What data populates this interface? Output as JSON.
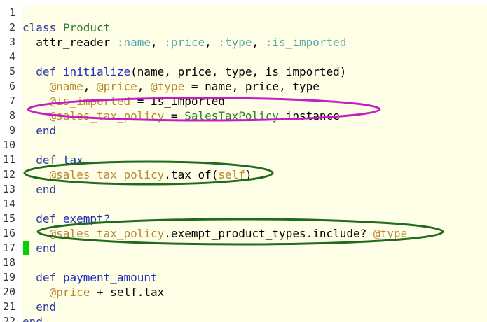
{
  "editor": {
    "lines": [
      {
        "num": "1",
        "tokens": []
      },
      {
        "num": "2",
        "tokens": [
          {
            "t": "class",
            "c": "kw"
          },
          {
            "t": " ",
            "c": "id"
          },
          {
            "t": "Product",
            "c": "cls"
          }
        ]
      },
      {
        "num": "3",
        "tokens": [
          {
            "t": "  attr_reader ",
            "c": "id"
          },
          {
            "t": ":name",
            "c": "sym"
          },
          {
            "t": ", ",
            "c": "id"
          },
          {
            "t": ":price",
            "c": "sym"
          },
          {
            "t": ", ",
            "c": "id"
          },
          {
            "t": ":type",
            "c": "sym"
          },
          {
            "t": ", ",
            "c": "id"
          },
          {
            "t": ":is_imported",
            "c": "sym"
          }
        ]
      },
      {
        "num": "4",
        "tokens": []
      },
      {
        "num": "5",
        "tokens": [
          {
            "t": "  ",
            "c": "id"
          },
          {
            "t": "def",
            "c": "kw"
          },
          {
            "t": " ",
            "c": "id"
          },
          {
            "t": "initialize",
            "c": "fn"
          },
          {
            "t": "(name, price, type, is_imported)",
            "c": "id"
          }
        ]
      },
      {
        "num": "6",
        "tokens": [
          {
            "t": "    ",
            "c": "id"
          },
          {
            "t": "@name",
            "c": "ivar"
          },
          {
            "t": ", ",
            "c": "id"
          },
          {
            "t": "@price",
            "c": "ivar"
          },
          {
            "t": ", ",
            "c": "id"
          },
          {
            "t": "@type",
            "c": "ivar"
          },
          {
            "t": " = name, price, type",
            "c": "id"
          }
        ]
      },
      {
        "num": "7",
        "tokens": [
          {
            "t": "    ",
            "c": "id"
          },
          {
            "t": "@is_imported",
            "c": "ivar"
          },
          {
            "t": " = is_imported",
            "c": "id"
          }
        ]
      },
      {
        "num": "8",
        "tokens": [
          {
            "t": "    ",
            "c": "id"
          },
          {
            "t": "@sales_tax_policy",
            "c": "ivar"
          },
          {
            "t": " = ",
            "c": "id"
          },
          {
            "t": "SalesTaxPolicy",
            "c": "cls"
          },
          {
            "t": ".instance",
            "c": "id"
          }
        ]
      },
      {
        "num": "9",
        "tokens": [
          {
            "t": "  ",
            "c": "id"
          },
          {
            "t": "end",
            "c": "kw"
          }
        ]
      },
      {
        "num": "10",
        "tokens": []
      },
      {
        "num": "11",
        "tokens": [
          {
            "t": "  ",
            "c": "id"
          },
          {
            "t": "def",
            "c": "kw"
          },
          {
            "t": " ",
            "c": "id"
          },
          {
            "t": "tax",
            "c": "fn"
          }
        ]
      },
      {
        "num": "12",
        "tokens": [
          {
            "t": "    ",
            "c": "id"
          },
          {
            "t": "@sales_tax_policy",
            "c": "ivar"
          },
          {
            "t": ".tax_of(",
            "c": "id"
          },
          {
            "t": "self",
            "c": "slf"
          },
          {
            "t": ")",
            "c": "id"
          }
        ]
      },
      {
        "num": "13",
        "tokens": [
          {
            "t": "  ",
            "c": "id"
          },
          {
            "t": "end",
            "c": "kw"
          }
        ]
      },
      {
        "num": "14",
        "tokens": []
      },
      {
        "num": "15",
        "tokens": [
          {
            "t": "  ",
            "c": "id"
          },
          {
            "t": "def",
            "c": "kw"
          },
          {
            "t": " ",
            "c": "id"
          },
          {
            "t": "exempt?",
            "c": "fn"
          }
        ]
      },
      {
        "num": "16",
        "tokens": [
          {
            "t": "    ",
            "c": "id"
          },
          {
            "t": "@sales_tax_policy",
            "c": "ivar"
          },
          {
            "t": ".exempt_product_types.include? ",
            "c": "id"
          },
          {
            "t": "@type",
            "c": "ivar"
          }
        ]
      },
      {
        "num": "17",
        "tokens": [
          {
            "t": "  ",
            "c": "id"
          },
          {
            "t": "end",
            "c": "kw"
          }
        ]
      },
      {
        "num": "18",
        "tokens": []
      },
      {
        "num": "19",
        "tokens": [
          {
            "t": "  ",
            "c": "id"
          },
          {
            "t": "def",
            "c": "kw"
          },
          {
            "t": " ",
            "c": "id"
          },
          {
            "t": "payment_amount",
            "c": "fn"
          }
        ]
      },
      {
        "num": "20",
        "tokens": [
          {
            "t": "    ",
            "c": "id"
          },
          {
            "t": "@price",
            "c": "ivar"
          },
          {
            "t": " + ",
            "c": "id"
          },
          {
            "t": "self",
            "c": "id"
          },
          {
            "t": ".tax",
            "c": "id"
          }
        ]
      },
      {
        "num": "21",
        "tokens": [
          {
            "t": "  ",
            "c": "id"
          },
          {
            "t": "end",
            "c": "kw"
          }
        ]
      },
      {
        "num": "22",
        "tokens": [
          {
            "t": "end",
            "c": "kw"
          }
        ]
      }
    ]
  },
  "annotations": {
    "ellipse_colors": [
      "#c21fc2",
      "#1f6b1f",
      "#1f6b1f"
    ]
  },
  "colors": {
    "code_background": "#ffffe8",
    "keyword": "#2f3aa3",
    "class_name": "#2e7d32",
    "symbol": "#5aa8aa",
    "instance_var": "#b8872e",
    "cursor_marker": "#00d200"
  }
}
